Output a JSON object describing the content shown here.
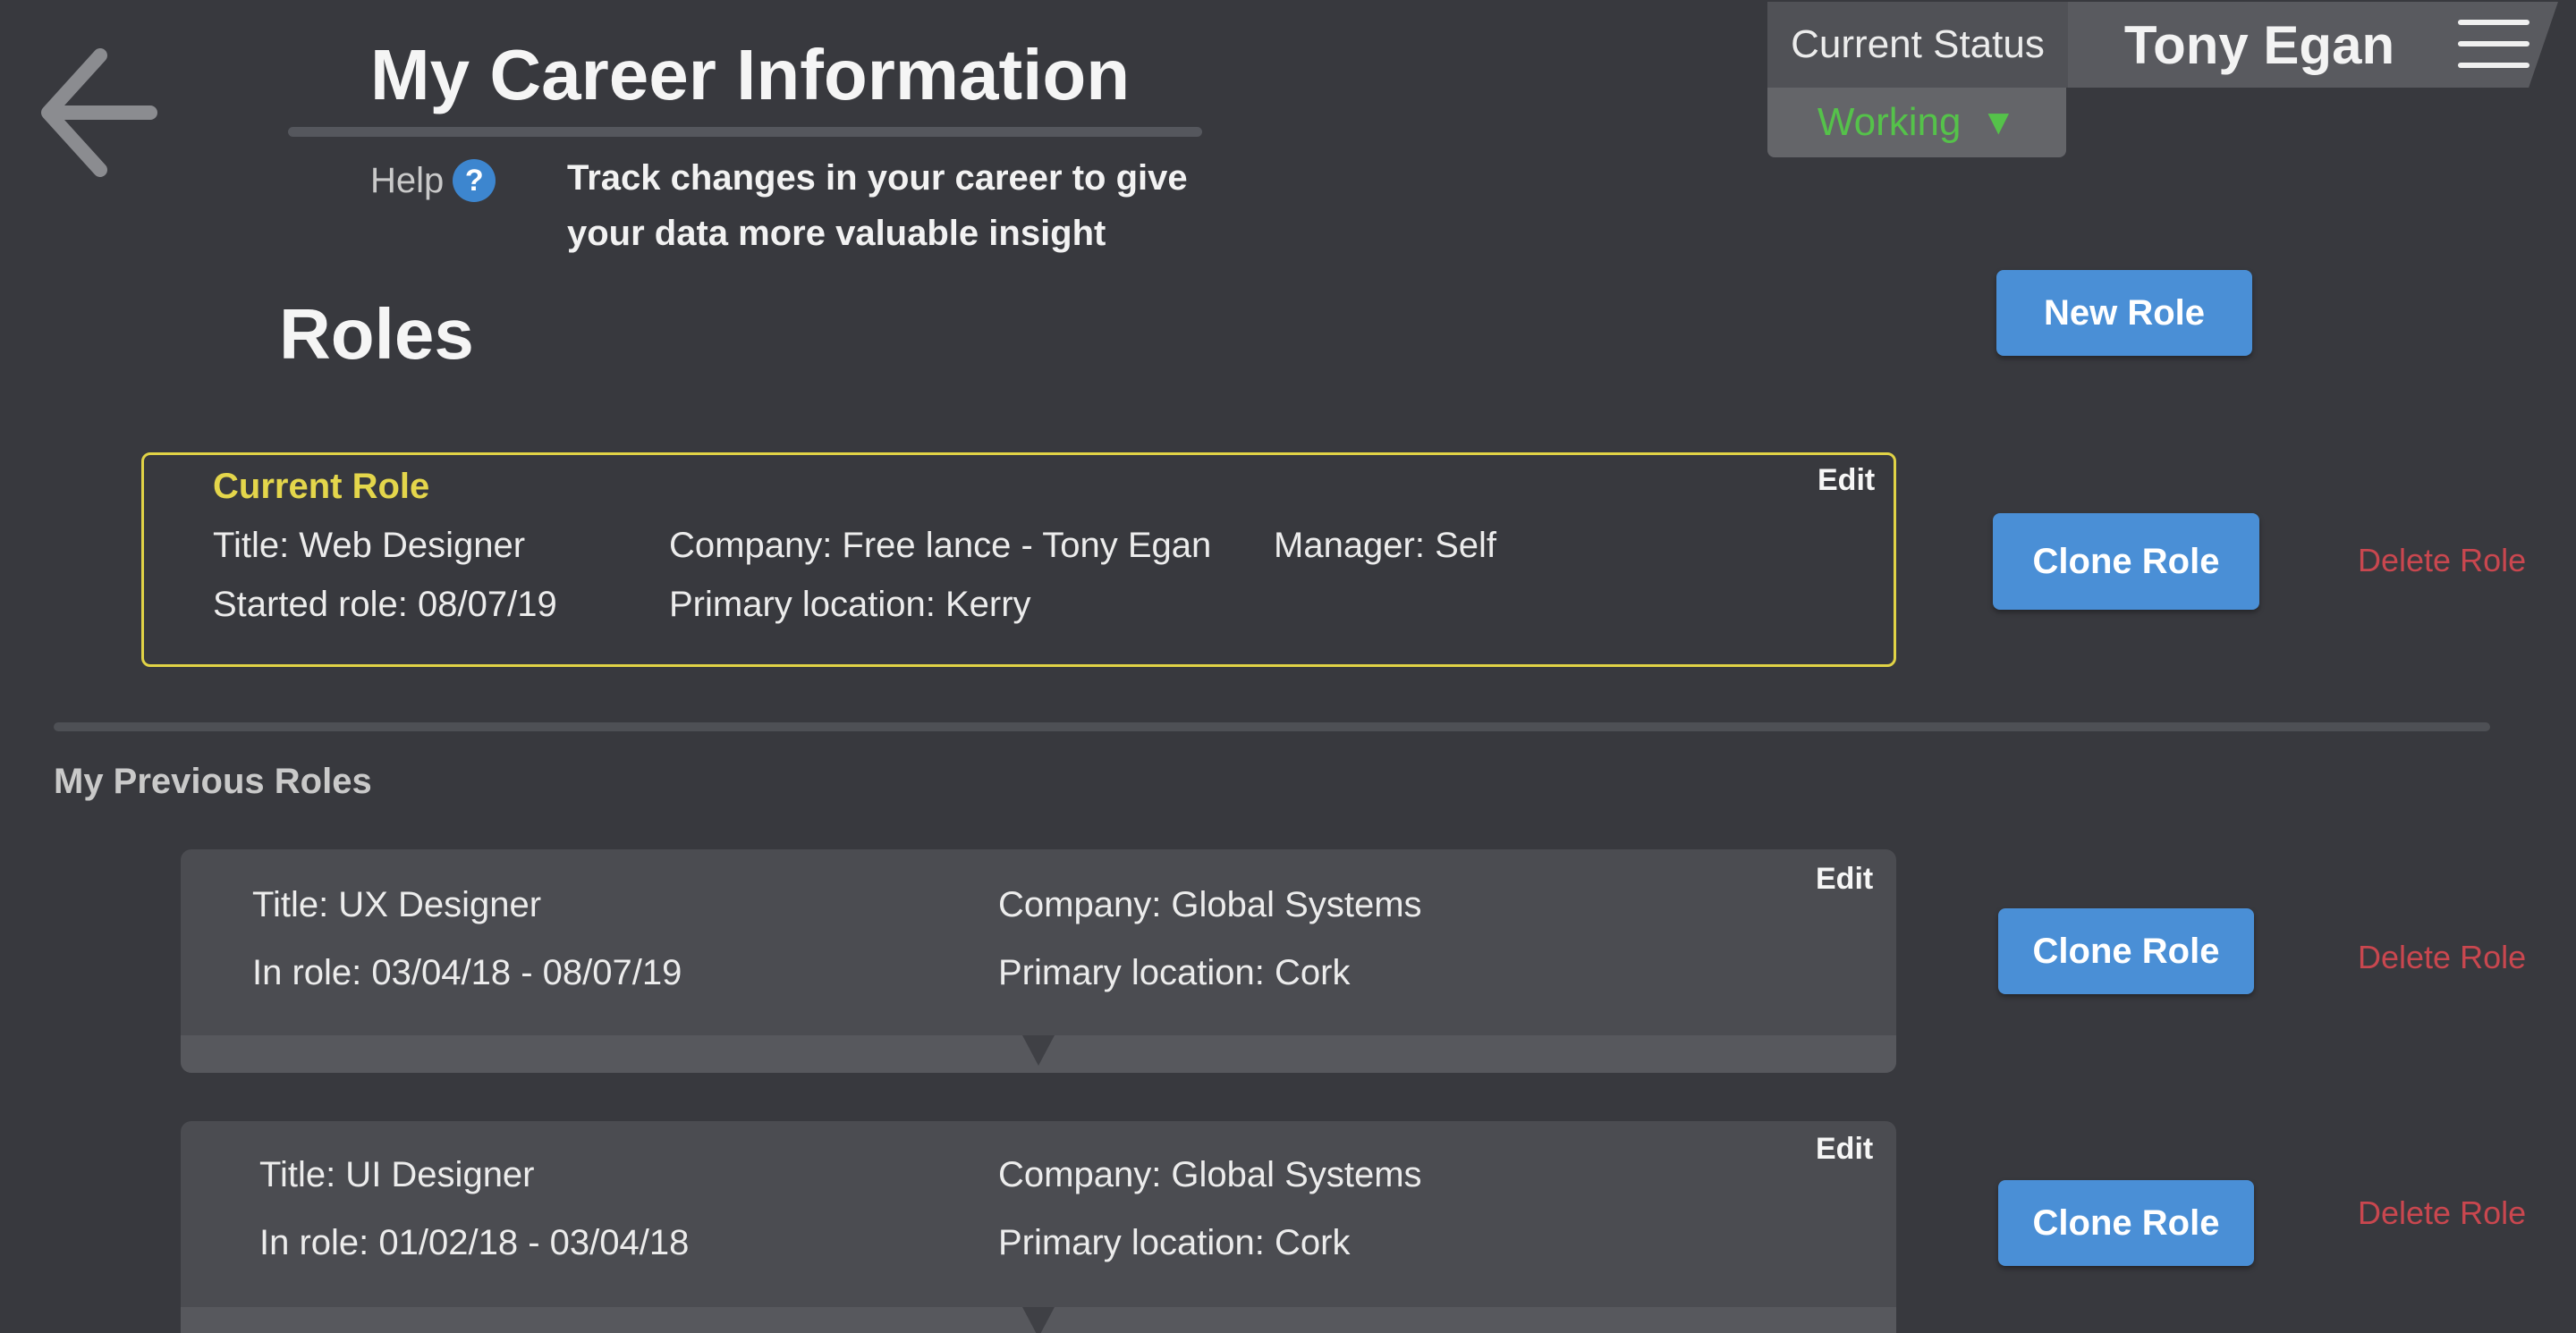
{
  "header": {
    "title": "My Career Information",
    "help_label": "Help",
    "help_icon_glyph": "?",
    "intro_line1": "Track changes in your career to give",
    "intro_line2": "your data more valuable insight"
  },
  "status": {
    "label": "Current Status",
    "value": "Working",
    "value_color": "#55c24a"
  },
  "user": {
    "name": "Tony Egan"
  },
  "icons": {
    "back": "arrow-left-icon",
    "menu": "hamburger-menu-icon",
    "help": "question-circle-icon",
    "caret": "triangle-down-icon"
  },
  "roles": {
    "heading": "Roles",
    "new_role_label": "New Role",
    "current": {
      "label": "Current Role",
      "edit_label": "Edit",
      "title": "Title: Web Designer",
      "company": "Company: Free lance - Tony Egan",
      "manager": "Manager: Self",
      "started": "Started role: 08/07/19",
      "location": "Primary location: Kerry",
      "clone_label": "Clone Role",
      "delete_label": "Delete Role"
    },
    "previous_heading": "My Previous Roles",
    "previous": [
      {
        "edit_label": "Edit",
        "title": "Title: UX Designer",
        "company": "Company: Global Systems",
        "period": "In role: 03/04/18 - 08/07/19",
        "location": "Primary location: Cork",
        "clone_label": "Clone Role",
        "delete_label": "Delete Role"
      },
      {
        "edit_label": "Edit",
        "title": "Title: UI Designer",
        "company": "Company: Global Systems",
        "period": "In role: 01/02/18 - 03/04/18",
        "location": "Primary location: Cork",
        "clone_label": "Clone Role",
        "delete_label": "Delete Role"
      }
    ]
  },
  "colors": {
    "background": "#38393e",
    "accent_blue": "#4a8fd6",
    "current_border": "#e1d346",
    "delete_red": "#c9474f"
  }
}
